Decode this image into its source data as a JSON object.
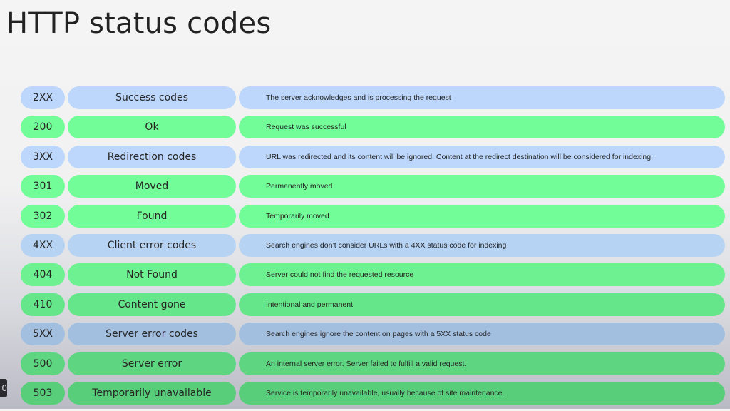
{
  "title": "HTTP status codes",
  "colors": {
    "category_row": "#bcd7fb",
    "code_row": "#72fd98",
    "text": "#262626"
  },
  "rows": [
    {
      "type": "category",
      "code": "2XX",
      "name": "Success codes",
      "description": "The server acknowledges and is processing the request"
    },
    {
      "type": "code",
      "code": "200",
      "name": "Ok",
      "description": "Request was successful"
    },
    {
      "type": "category",
      "code": "3XX",
      "name": "Redirection codes",
      "description": "URL was redirected and its content will be ignored. Content at the redirect destination will be considered for indexing."
    },
    {
      "type": "code",
      "code": "301",
      "name": "Moved",
      "description": "Permanently moved"
    },
    {
      "type": "code",
      "code": "302",
      "name": "Found",
      "description": "Temporarily moved"
    },
    {
      "type": "category",
      "code": "4XX",
      "name": "Client error codes",
      "description": "Search engines don’t consider URLs with a 4XX status code for indexing"
    },
    {
      "type": "code",
      "code": "404",
      "name": "Not Found",
      "description": "Server could not find the requested resource"
    },
    {
      "type": "code",
      "code": "410",
      "name": "Content gone",
      "description": "Intentional and permanent"
    },
    {
      "type": "category",
      "code": "5XX",
      "name": "Server error codes",
      "description": "Search engines ignore the content on pages with a 5XX status code"
    },
    {
      "type": "code",
      "code": "500",
      "name": "Server error",
      "description": "An internal server error. Server failed to fulfill a valid request."
    },
    {
      "type": "code",
      "code": "503",
      "name": "Temporarily unavailable",
      "description": "Service is temporarily unavailable, usually because of site maintenance."
    }
  ],
  "overlay": {
    "glyph": "0"
  }
}
